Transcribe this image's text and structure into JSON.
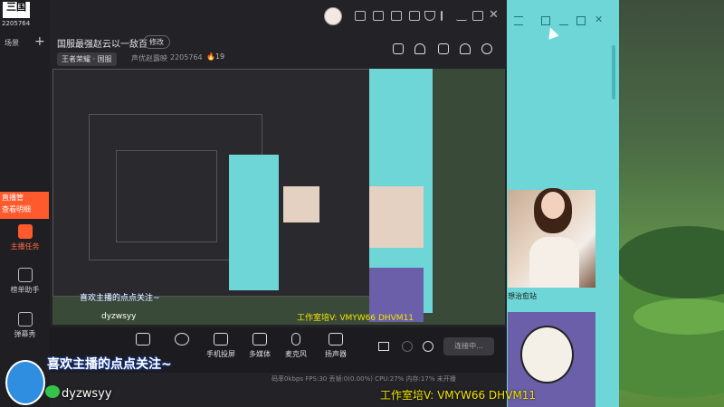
{
  "sidebar": {
    "logo": "三国",
    "account_id": "2205764",
    "scene_label": "场景",
    "promo": "直播管\n查看明细",
    "items": [
      {
        "label": "主播任务",
        "icon": "task-icon"
      },
      {
        "label": "榜单助手",
        "icon": "star-icon"
      },
      {
        "label": "弹幕秀",
        "icon": "tv-icon"
      }
    ]
  },
  "header": {
    "room_title": "国服最强赵云以一敌百",
    "edit_label": "修改",
    "category": "王者荣耀 · 国服",
    "voice_label": "声优赵露映",
    "room_id": "2205764",
    "fire_count": "19"
  },
  "toolbar": {
    "items": [
      {
        "label": "",
        "icon": "subtitle-icon"
      },
      {
        "label": "",
        "icon": "camera-icon"
      },
      {
        "label": "手机投屏",
        "icon": "phone-cast-icon"
      },
      {
        "label": "多媒体",
        "icon": "media-icon"
      },
      {
        "label": "麦克风",
        "icon": "mic-icon"
      },
      {
        "label": "扬声器",
        "icon": "speaker-icon"
      }
    ],
    "connect_label": "连接中..."
  },
  "status": {
    "text": "码率0kbps  FPS:30  丢帧:0(0.00%)  CPU:27%  内存:17%  未开播"
  },
  "overlay": {
    "follow_text": "喜欢主播的点点关注~",
    "wechat_text": "dyzwsyy",
    "studio_text": "工作室培V: VMYW66  DHVM11"
  },
  "cyan_panel": {
    "caption": "想治愈站"
  },
  "colors": {
    "accent": "#ff5a2d",
    "cyan": "#6ed6d6",
    "studio_yellow": "#f4e500"
  }
}
